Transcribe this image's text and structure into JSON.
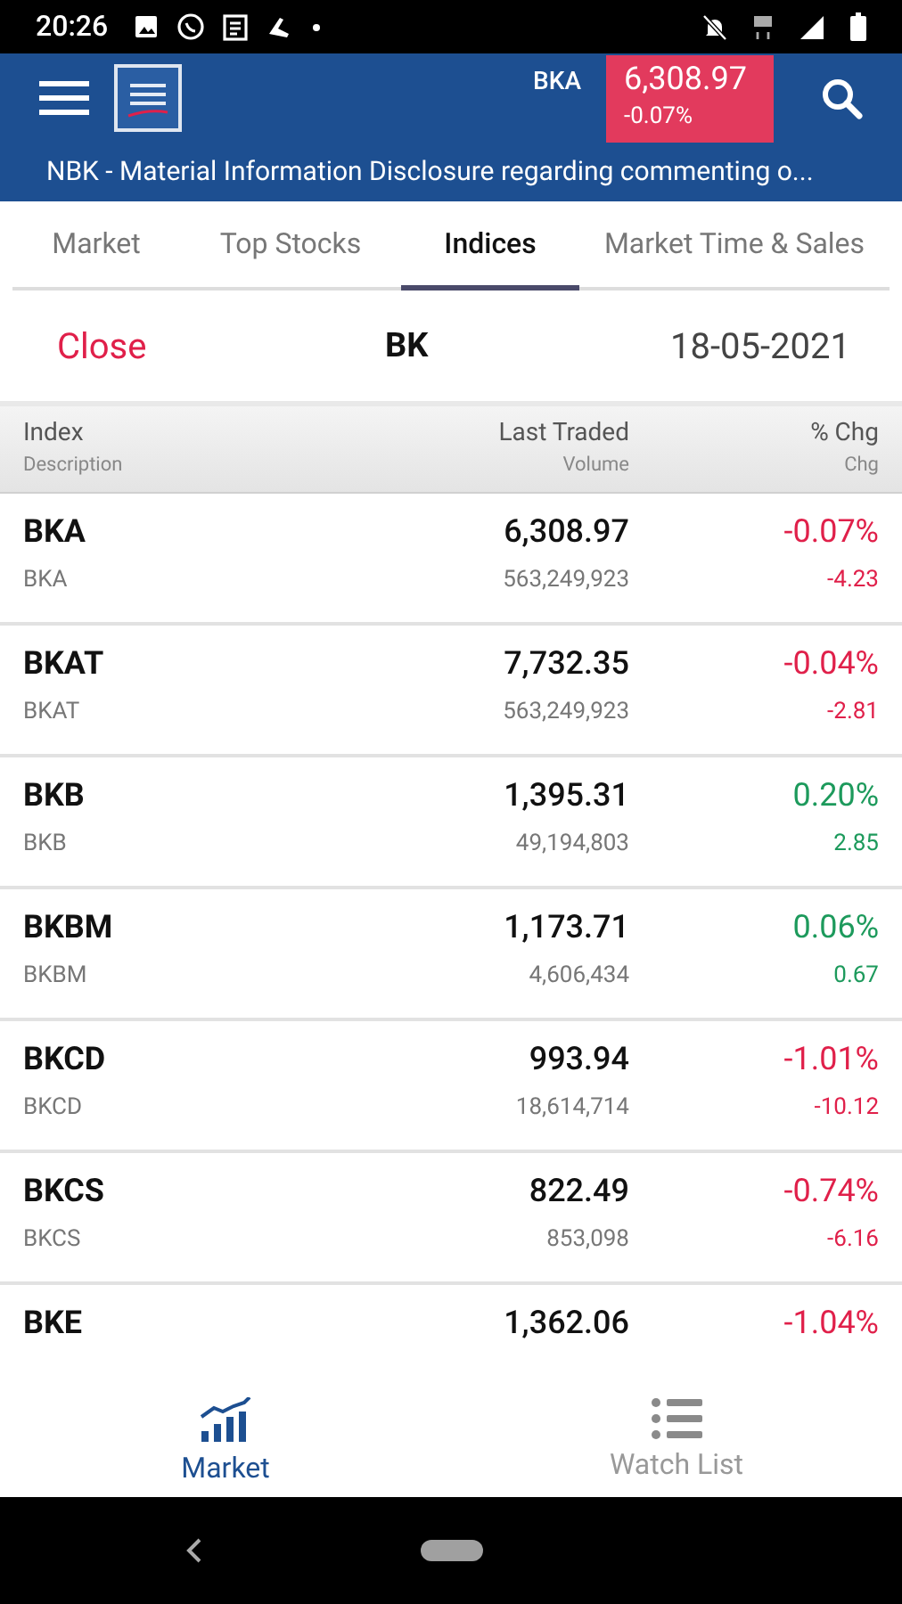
{
  "status_bar": {
    "time": "20:26"
  },
  "header": {
    "ticker": {
      "symbol": "BKA",
      "value": "6,308.97",
      "change": "-0.07%",
      "color": "#e23a5d"
    }
  },
  "news_ticker": "NBK - Material Information Disclosure regarding commenting o...",
  "tabs": [
    {
      "label": "Market",
      "selected": false
    },
    {
      "label": "Top Stocks",
      "selected": false
    },
    {
      "label": "Indices",
      "selected": true
    },
    {
      "label": "Market Time & Sales",
      "selected": false
    }
  ],
  "session": {
    "status": "Close",
    "market": "BK",
    "date": "18-05-2021"
  },
  "table": {
    "columns": [
      {
        "title": "Index",
        "subtitle": "Description"
      },
      {
        "title": "Last Traded",
        "subtitle": "Volume"
      },
      {
        "title": "% Chg",
        "subtitle": "Chg"
      }
    ],
    "rows": [
      {
        "index": "BKA",
        "description": "BKA",
        "last_traded": "6,308.97",
        "volume": "563,249,923",
        "pct_chg": "-0.07%",
        "chg": "-4.23",
        "color": "#e0204a"
      },
      {
        "index": "BKAT",
        "description": "BKAT",
        "last_traded": "7,732.35",
        "volume": "563,249,923",
        "pct_chg": "-0.04%",
        "chg": "-2.81",
        "color": "#e0204a"
      },
      {
        "index": "BKB",
        "description": "BKB",
        "last_traded": "1,395.31",
        "volume": "49,194,803",
        "pct_chg": "0.20%",
        "chg": "2.85",
        "color": "#1d9a5c"
      },
      {
        "index": "BKBM",
        "description": "BKBM",
        "last_traded": "1,173.71",
        "volume": "4,606,434",
        "pct_chg": "0.06%",
        "chg": "0.67",
        "color": "#1d9a5c"
      },
      {
        "index": "BKCD",
        "description": "BKCD",
        "last_traded": "993.94",
        "volume": "18,614,714",
        "pct_chg": "-1.01%",
        "chg": "-10.12",
        "color": "#e0204a"
      },
      {
        "index": "BKCS",
        "description": "BKCS",
        "last_traded": "822.49",
        "volume": "853,098",
        "pct_chg": "-0.74%",
        "chg": "-6.16",
        "color": "#e0204a"
      },
      {
        "index": "BKE",
        "last_traded": "1,362.06",
        "pct_chg": "-1.04%",
        "color": "#e0204a"
      }
    ]
  },
  "bottom_nav": [
    {
      "label": "Market",
      "kind": "chart",
      "selected": true
    },
    {
      "label": "Watch List",
      "kind": "list",
      "selected": false
    }
  ]
}
